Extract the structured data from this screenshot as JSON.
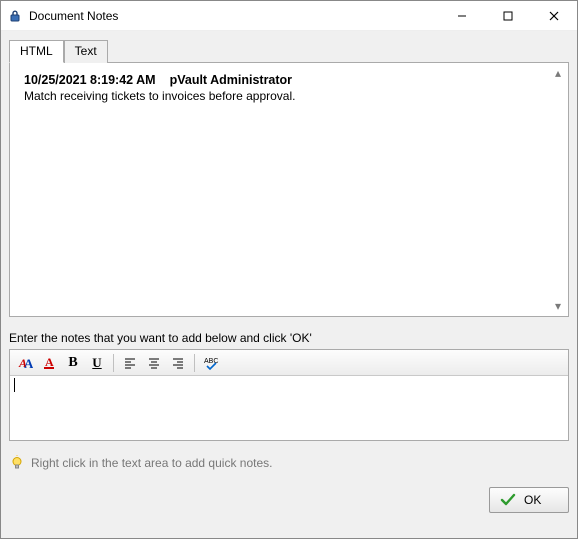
{
  "window": {
    "title": "Document Notes"
  },
  "tabs": {
    "html": "HTML",
    "text": "Text"
  },
  "note": {
    "timestamp": "10/25/2021 8:19:42 AM",
    "author": "pVault Administrator",
    "body": "Match receiving tickets to invoices before approval."
  },
  "instruction": "Enter the notes that you want to add below and click 'OK'",
  "hint": "Right click in the text area to add quick notes.",
  "buttons": {
    "ok": "OK"
  }
}
